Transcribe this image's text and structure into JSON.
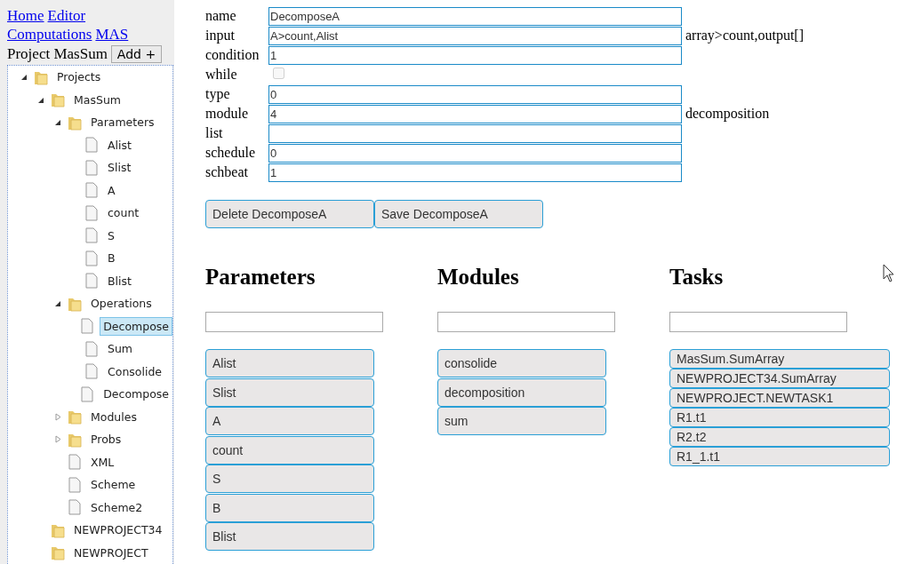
{
  "nav_links": [
    "Home",
    "Editor",
    "Computations",
    "MAS"
  ],
  "project": {
    "label": "Project MasSum",
    "add_button": "Add +"
  },
  "tree": [
    {
      "label": "Projects",
      "kind": "folder",
      "expanded": true,
      "selected": false,
      "children": [
        {
          "label": "MasSum",
          "kind": "folder",
          "expanded": true,
          "selected": false,
          "children": [
            {
              "label": "Parameters",
              "kind": "folder",
              "expanded": true,
              "selected": false,
              "children": [
                {
                  "label": "Alist",
                  "kind": "file",
                  "selected": false
                },
                {
                  "label": "Slist",
                  "kind": "file",
                  "selected": false
                },
                {
                  "label": "A",
                  "kind": "file",
                  "selected": false
                },
                {
                  "label": "count",
                  "kind": "file",
                  "selected": false
                },
                {
                  "label": "S",
                  "kind": "file",
                  "selected": false
                },
                {
                  "label": "B",
                  "kind": "file",
                  "selected": false
                },
                {
                  "label": "Blist",
                  "kind": "file",
                  "selected": false
                }
              ]
            },
            {
              "label": "Operations",
              "kind": "folder",
              "expanded": true,
              "selected": false,
              "children": [
                {
                  "label": "Decompose",
                  "kind": "file",
                  "selected": true
                },
                {
                  "label": "Sum",
                  "kind": "file",
                  "selected": false
                },
                {
                  "label": "Consolide",
                  "kind": "file",
                  "selected": false
                },
                {
                  "label": "Decompose",
                  "kind": "file",
                  "selected": false
                }
              ]
            },
            {
              "label": "Modules",
              "kind": "folder",
              "expanded": false,
              "selected": false
            },
            {
              "label": "Probs",
              "kind": "folder",
              "expanded": false,
              "selected": false
            },
            {
              "label": "XML",
              "kind": "file",
              "selected": false
            },
            {
              "label": "Scheme",
              "kind": "file",
              "selected": false
            },
            {
              "label": "Scheme2",
              "kind": "file",
              "selected": false
            }
          ]
        },
        {
          "label": "NEWPROJECT34",
          "kind": "folder",
          "selected": false
        },
        {
          "label": "NEWPROJECT",
          "kind": "folder",
          "selected": false
        }
      ]
    }
  ],
  "form": [
    {
      "label": "name",
      "kind": "text",
      "value": "DecomposeA"
    },
    {
      "label": "input",
      "kind": "text",
      "value": "A>count,Alist",
      "note": "array>count,output[]"
    },
    {
      "label": "condition",
      "kind": "text",
      "value": "1"
    },
    {
      "label": "while",
      "kind": "checkbox",
      "checked": false
    },
    {
      "label": "type",
      "kind": "text",
      "value": "0"
    },
    {
      "label": "module",
      "kind": "text",
      "value": "4",
      "note": "decomposition"
    },
    {
      "label": "list",
      "kind": "text"
    },
    {
      "label": "schedule",
      "kind": "text",
      "value": "0"
    },
    {
      "label": "schbeat",
      "kind": "text",
      "value": "1"
    }
  ],
  "actions": [
    "Delete DecomposeA",
    "Save DecomposeA"
  ],
  "columns": [
    {
      "title": "Parameters",
      "kind": "tall",
      "items": [
        "Alist",
        "Slist",
        "A",
        "count",
        "S",
        "B",
        "Blist"
      ]
    },
    {
      "title": "Modules",
      "kind": "tall",
      "items": [
        "consolide",
        "decomposition",
        "sum"
      ]
    },
    {
      "title": "Tasks",
      "kind": "compact",
      "items": [
        "MasSum.SumArray",
        "NEWPROJECT34.SumArray",
        "NEWPROJECT.NEWTASK1",
        "R1.t1",
        "R2.t2",
        "R1_1.t1"
      ]
    }
  ]
}
